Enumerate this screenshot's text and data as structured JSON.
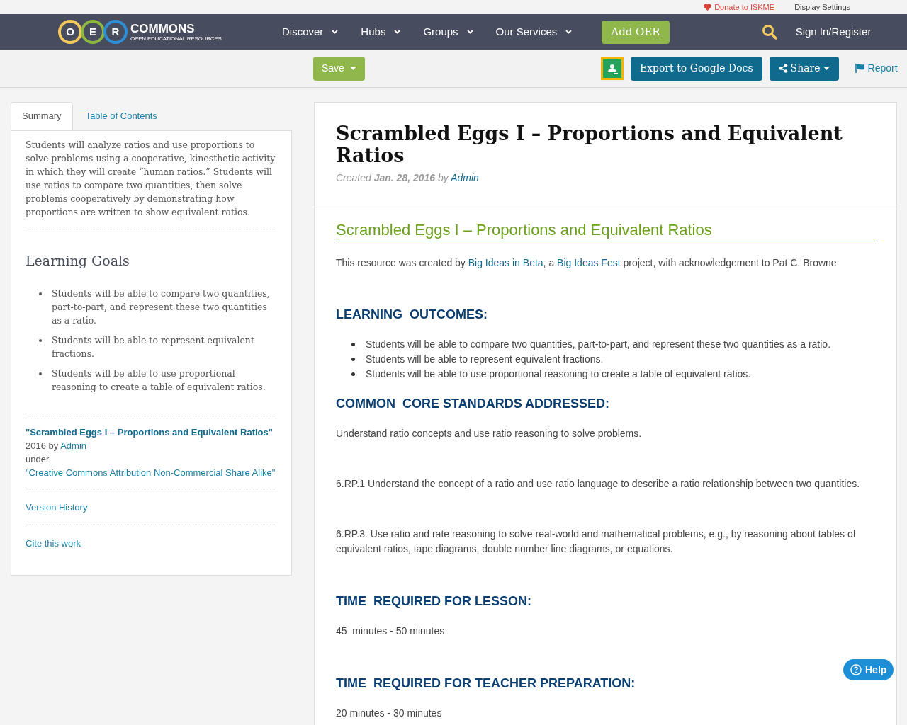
{
  "top_bar": {
    "donate": "Donate to ISKME",
    "display_settings": "Display Settings"
  },
  "nav": {
    "logo_letters": [
      "O",
      "E",
      "R"
    ],
    "logo_title": "COMMONS",
    "logo_subtitle": "OPEN EDUCATIONAL RESOURCES",
    "menu": [
      {
        "label": "Discover"
      },
      {
        "label": "Hubs"
      },
      {
        "label": "Groups"
      },
      {
        "label": "Our Services"
      }
    ],
    "add_button": "Add OER",
    "sign_in": "Sign In/Register"
  },
  "toolbar": {
    "save": "Save",
    "export": "Export to Google Docs",
    "share": "Share",
    "report": "Report"
  },
  "sidebar": {
    "tabs": [
      {
        "label": "Summary",
        "selected": true
      },
      {
        "label": "Table of Contents",
        "selected": false
      }
    ],
    "summary": "Students will analyze ratios and use proportions to solve problems using a cooperative, kinesthetic activity in which they will create “human ratios.” Students will use ratios to compare two quantities, then solve problems cooperatively by demonstrating how proportions are written to show equivalent ratios.",
    "goals_heading": "Learning Goals",
    "goals": [
      "Students will be able to compare two quantities, part-to-part, and represent these two quantities as a ratio.",
      "Students will be able to represent equivalent fractions.",
      "Students will be able to use proportional reasoning to create a table of equivalent ratios."
    ],
    "credit": {
      "title": "\"Scrambled Eggs I – Proportions and Equivalent Ratios\"",
      "year_by": "2016 by",
      "author": "Admin",
      "under": "under",
      "license": "\"Creative Commons Attribution Non-Commercial Share Alike\""
    },
    "links": [
      "Version History",
      "Cite this work"
    ]
  },
  "resource": {
    "title": "Scrambled Eggs I – Proportions and Equivalent Ratios",
    "created_label": "Created",
    "date": "Jan. 28, 2016",
    "by": "by",
    "author": "Admin",
    "content": [
      {
        "kind": "title",
        "text": "Scrambled Eggs I – Proportions and Equivalent Ratios"
      },
      {
        "kind": "credit",
        "parts": [
          {
            "text": "This resource was created by ",
            "link": false
          },
          {
            "text": "Big Ideas in Beta",
            "link": true
          },
          {
            "text": ", a ",
            "link": false
          },
          {
            "text": "Big Ideas Fest",
            "link": true
          },
          {
            "text": " project, with acknowledgement to Pat C. Browne",
            "link": false
          }
        ]
      },
      {
        "kind": "heading",
        "text": "LEARNING  OUTCOMES:"
      },
      {
        "kind": "list",
        "items": [
          "Students will be able to compare two quantities, part-to-part, and represent these two quantities as a ratio.",
          "Students will be able to represent equivalent fractions.",
          "Students will be able to use proportional reasoning to create a table of equivalent ratios."
        ]
      },
      {
        "kind": "heading",
        "text": "COMMON  CORE STANDARDS ADDRESSED:"
      },
      {
        "kind": "paragraph",
        "text": "Understand ratio concepts and use ratio reasoning to solve problems."
      },
      {
        "kind": "paragraph",
        "text": "6.RP.1 Understand the concept of a ratio and use ratio language to describe a ratio relationship between two quantities."
      },
      {
        "kind": "paragraph",
        "text": "6.RP.3. Use ratio and rate reasoning to solve real-world and mathematical problems, e.g., by reasoning about tables of equivalent ratios, tape diagrams, double number line diagrams, or equations."
      },
      {
        "kind": "heading",
        "text": "TIME  REQUIRED FOR LESSON:"
      },
      {
        "kind": "paragraph",
        "text": "45  minutes - 50 minutes"
      },
      {
        "kind": "heading",
        "text": "TIME  REQUIRED FOR TEACHER PREPARATION:"
      },
      {
        "kind": "paragraph",
        "text": "20 minutes - 30 minutes"
      }
    ]
  },
  "help_button": "Help"
}
